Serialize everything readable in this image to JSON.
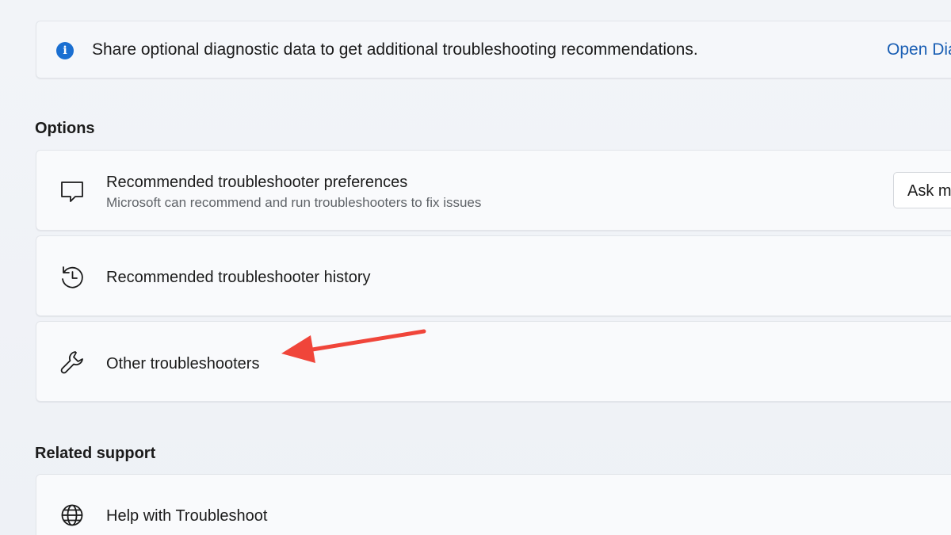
{
  "banner": {
    "text": "Share optional diagnostic data to get additional troubleshooting recommendations.",
    "link": "Open Dia"
  },
  "options": {
    "heading": "Options",
    "items": [
      {
        "title": "Recommended troubleshooter preferences",
        "subtitle": "Microsoft can recommend and run troubleshooters to fix issues",
        "icon": "chat-bubble-icon",
        "control_label": "Ask m"
      },
      {
        "title": "Recommended troubleshooter history",
        "icon": "history-icon"
      },
      {
        "title": "Other troubleshooters",
        "icon": "wrench-icon"
      }
    ]
  },
  "related_support": {
    "heading": "Related support",
    "items": [
      {
        "title": "Help with Troubleshoot",
        "icon": "globe-icon"
      }
    ]
  },
  "colors": {
    "accent": "#1a6fd1",
    "link": "#1a5fb4",
    "annotation_arrow": "#f0453a"
  }
}
